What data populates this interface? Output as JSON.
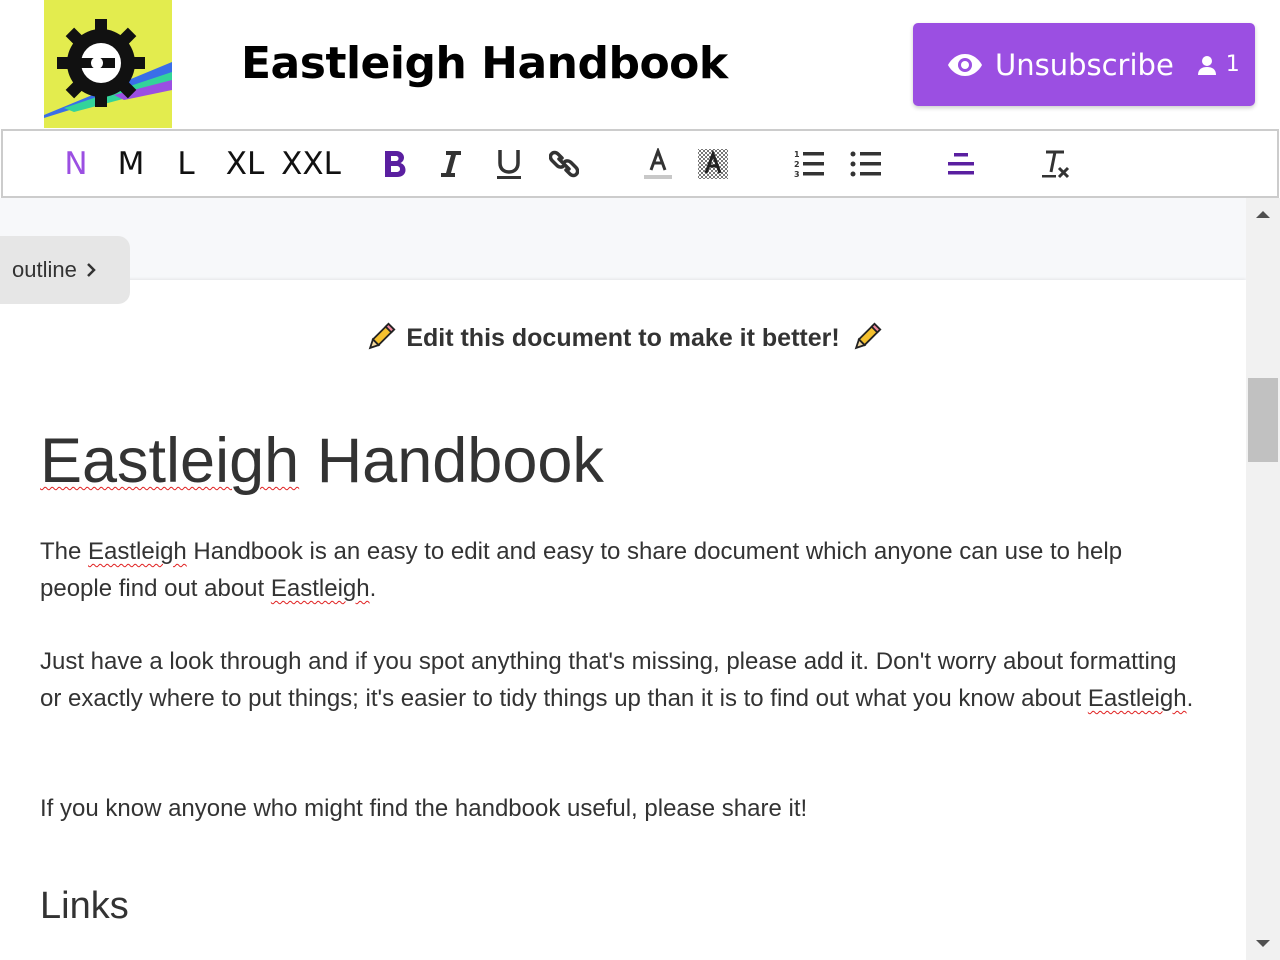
{
  "header": {
    "title": "Eastleigh Handbook",
    "subscribe_button": {
      "label": "Unsubscribe",
      "count": "1",
      "icon": "eye-icon",
      "count_icon": "person-icon"
    }
  },
  "toolbar": {
    "sizes": [
      "N",
      "M",
      "L",
      "XL",
      "XXL"
    ],
    "active_size": "N",
    "buttons": [
      "bold-icon",
      "italic-icon",
      "underline-icon",
      "link-icon",
      "text-color-icon",
      "highlight-icon",
      "ordered-list-icon",
      "bullet-list-icon",
      "align-center-icon",
      "clear-format-icon"
    ]
  },
  "outline": {
    "label": "outline"
  },
  "document": {
    "banner": "Edit this document to make it better!",
    "title_words": [
      "Eastleigh",
      "Handbook"
    ],
    "para1": {
      "a": "The ",
      "b": "Eastleigh",
      "c": " Handbook is an easy to edit and easy to share document which anyone can use to help people find out about ",
      "d": "Eastleigh",
      "e": "."
    },
    "para2": {
      "a": "Just have a look through and if you spot anything that's missing, please add it. Don't worry about formatting or exactly where to put things; it's easier to tidy things up than it is to find out what you know about ",
      "b": "Eastleigh",
      "c": "."
    },
    "para3": "If you know anyone who might find the handbook useful, please share it!",
    "links_heading": "Links"
  },
  "colors": {
    "accent": "#9b4fe2",
    "logo_bg": "#e3ec4e",
    "toolbar_active": "#5a1fa0",
    "spelling_underline": "#e02020"
  }
}
